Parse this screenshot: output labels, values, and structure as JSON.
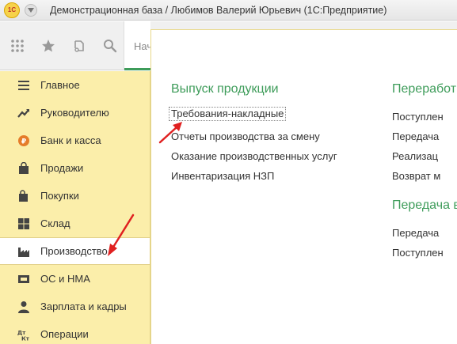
{
  "window": {
    "title": "Демонстрационная база / Любимов Валерий Юрьевич  (1С:Предприятие)",
    "logo_text": "1С"
  },
  "toolbar": {
    "tab_label": "Нач"
  },
  "sidebar": {
    "items": [
      {
        "label": "Главное",
        "icon": "list-icon"
      },
      {
        "label": "Руководителю",
        "icon": "trend-icon"
      },
      {
        "label": "Банк и касса",
        "icon": "coin-icon"
      },
      {
        "label": "Продажи",
        "icon": "bag-icon"
      },
      {
        "label": "Покупки",
        "icon": "cart-icon"
      },
      {
        "label": "Склад",
        "icon": "grid-icon"
      },
      {
        "label": "Производство",
        "icon": "factory-icon"
      },
      {
        "label": "ОС и НМА",
        "icon": "assets-icon"
      },
      {
        "label": "Зарплата и кадры",
        "icon": "people-icon"
      },
      {
        "label": "Операции",
        "icon": "operations-icon"
      }
    ],
    "active_index": 6
  },
  "panel": {
    "col1": {
      "title": "Выпуск продукции",
      "links": [
        "Требования-накладные",
        "Отчеты производства за смену",
        "Оказание производственных услуг",
        "Инвентаризация НЗП"
      ]
    },
    "col2": {
      "title": "Переработ",
      "links": [
        "Поступлен",
        "Передача",
        "Реализац",
        "Возврат м"
      ],
      "title2": "Передача в",
      "links2": [
        "Передача",
        "Поступлен"
      ]
    }
  },
  "colors": {
    "accent_green": "#3e9c5a",
    "sidebar_bg": "#fbeeaa",
    "arrow_red": "#e02020"
  }
}
